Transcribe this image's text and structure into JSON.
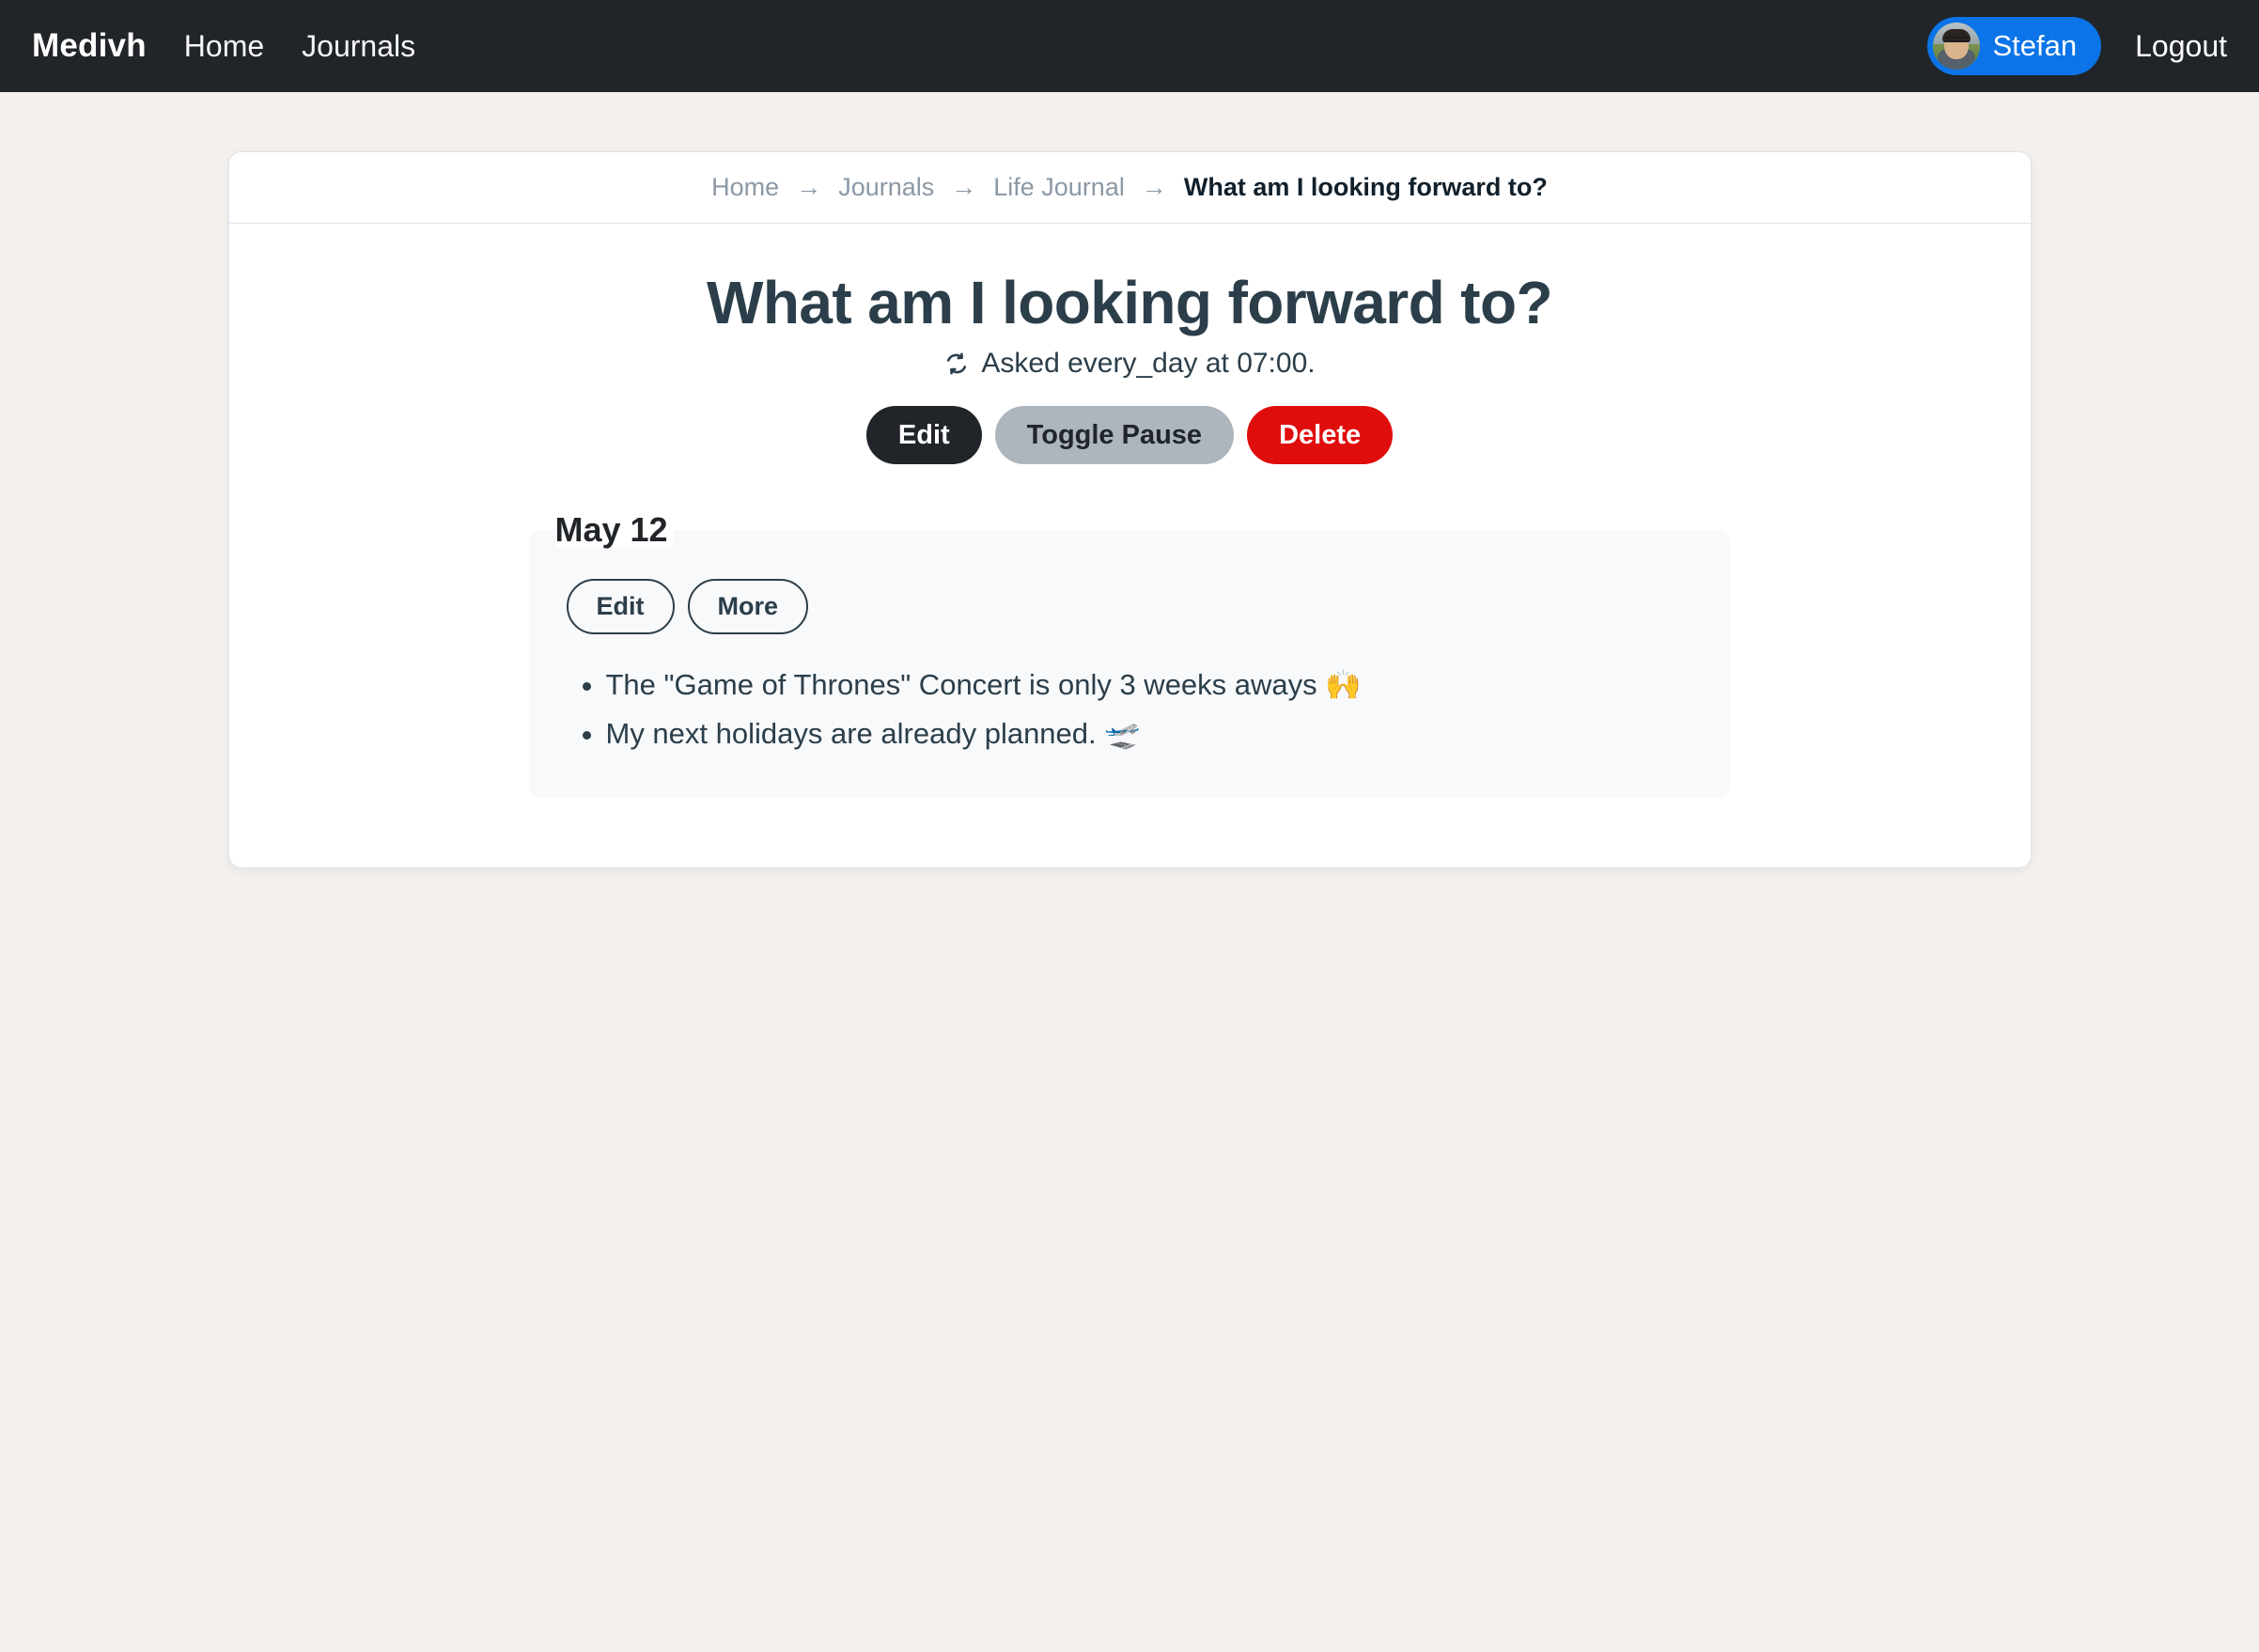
{
  "navbar": {
    "brand": "Medivh",
    "links": [
      {
        "label": "Home",
        "name": "nav-link-home"
      },
      {
        "label": "Journals",
        "name": "nav-link-journals"
      }
    ],
    "user": {
      "name": "Stefan",
      "avatar_alt": "user-avatar-photo",
      "pill_color": "#0b74e8"
    },
    "logout_label": "Logout",
    "background_color": "#212529"
  },
  "breadcrumb": {
    "separator": "→",
    "items": [
      {
        "label": "Home",
        "current": false
      },
      {
        "label": "Journals",
        "current": false
      },
      {
        "label": "Life Journal",
        "current": false
      },
      {
        "label": "What am I looking forward to?",
        "current": true
      }
    ]
  },
  "question": {
    "title": "What am I looking forward to?",
    "schedule_icon": "cycle-arrows-icon",
    "schedule_text": "Asked every_day at 07:00.",
    "actions": [
      {
        "label": "Edit",
        "style": "dark",
        "name": "edit-question-button"
      },
      {
        "label": "Toggle Pause",
        "style": "secondary",
        "name": "toggle-pause-button"
      },
      {
        "label": "Delete",
        "style": "danger",
        "name": "delete-question-button"
      }
    ]
  },
  "entries": [
    {
      "date": "May 12",
      "buttons": [
        {
          "label": "Edit",
          "name": "entry-edit-button"
        },
        {
          "label": "More",
          "name": "entry-more-button"
        }
      ],
      "items": [
        "The \"Game of Thrones\" Concert is only 3 weeks aways 🙌",
        "My next holidays are already planned. 🛫"
      ]
    }
  ],
  "colors": {
    "page_background": "#f4f0ed",
    "card_background": "#ffffff",
    "entry_card_background": "#f8f9fb",
    "text_primary": "#2b3e4a",
    "muted": "#8b98a6",
    "danger": "#e00d0d",
    "secondary": "#adb5bd"
  }
}
